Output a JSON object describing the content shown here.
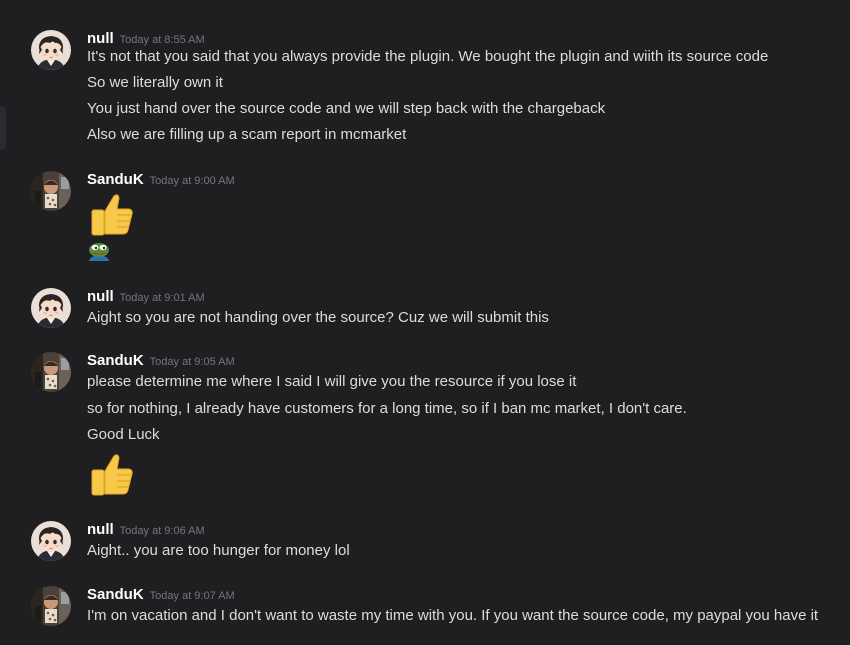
{
  "messages": [
    {
      "username": "null",
      "timestamp": "Today at 8:55 AM",
      "avatar_icon": "anime-boy-avatar",
      "lines": [
        "It's not that you said that you always provide the plugin. We bought the plugin and wiith its source code",
        "So we literally own it",
        "You just hand over the source code and we will step back with the chargeback",
        "Also we are filling up a scam report in mcmarket"
      ]
    },
    {
      "username": "SanduK",
      "timestamp": "Today at 9:00 AM",
      "avatar_icon": "photo-avatar",
      "emojis": [
        "thumbs-up-emoji",
        "pepe-frog-emoji"
      ]
    },
    {
      "username": "null",
      "timestamp": "Today at 9:01 AM",
      "avatar_icon": "anime-boy-avatar",
      "lines": [
        "Aight so you are not handing over the source? Cuz we will submit this"
      ]
    },
    {
      "username": "SanduK",
      "timestamp": "Today at 9:05 AM",
      "avatar_icon": "photo-avatar",
      "lines": [
        "please determine me where I said I will give you the resource if you lose it",
        "so for nothing, I already have customers for a long time, so if I ban mc market, I don't care.",
        "Good Luck"
      ],
      "emojis": [
        "thumbs-up-emoji"
      ]
    },
    {
      "username": "null",
      "timestamp": "Today at 9:06 AM",
      "avatar_icon": "anime-boy-avatar",
      "lines": [
        "Aight.. you are too hunger for money lol"
      ]
    },
    {
      "username": "SanduK",
      "timestamp": "Today at 9:07 AM",
      "avatar_icon": "photo-avatar",
      "lines": [
        "I'm on vacation and I don't want to waste my time with you. If you want the source code, my paypal you have it"
      ]
    }
  ],
  "colors": {
    "background": "#1f1f21",
    "username": "#ffffff",
    "timestamp": "#72767d",
    "text": "#dcddde"
  }
}
